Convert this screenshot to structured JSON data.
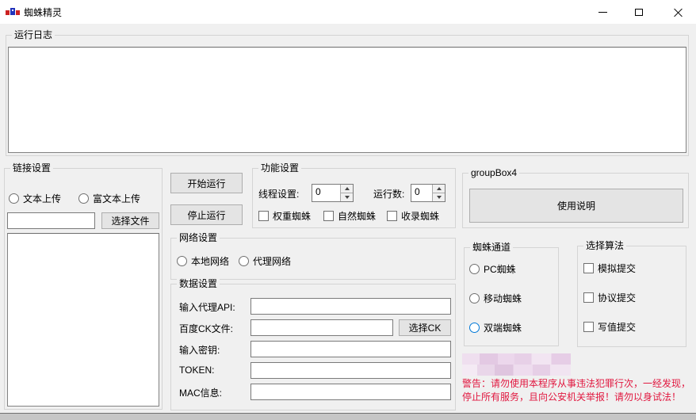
{
  "window": {
    "title": "蜘蛛精灵"
  },
  "icons": {
    "app": "spider-logo-icon",
    "minimize": "minimize-icon",
    "maximize": "maximize-icon",
    "close": "close-icon"
  },
  "log_group": {
    "label": "运行日志",
    "content": ""
  },
  "link_group": {
    "label": "链接设置",
    "radios": [
      {
        "label": "文本上传",
        "checked": false
      },
      {
        "label": "富文本上传",
        "checked": false
      }
    ],
    "file_input_value": "",
    "choose_file_button": "选择文件",
    "list_items": []
  },
  "run_buttons": {
    "start": "开始运行",
    "stop": "停止运行"
  },
  "function_group": {
    "label": "功能设置",
    "thread_label": "线程设置:",
    "thread_value": "0",
    "run_count_label": "运行数:",
    "run_count_value": "0",
    "checkboxes": [
      {
        "label": "权重蜘蛛",
        "checked": false
      },
      {
        "label": "自然蜘蛛",
        "checked": false
      },
      {
        "label": "收录蜘蛛",
        "checked": false
      }
    ]
  },
  "network_group": {
    "label": "网络设置",
    "radios": [
      {
        "label": "本地网络",
        "checked": false
      },
      {
        "label": "代理网络",
        "checked": false
      }
    ]
  },
  "data_group": {
    "label": "数据设置",
    "fields": [
      {
        "label": "输入代理API:",
        "value": ""
      },
      {
        "label": "百度CK文件:",
        "value": "",
        "button": "选择CK"
      },
      {
        "label": "输入密钥:",
        "value": ""
      },
      {
        "label": "TOKEN:",
        "value": ""
      },
      {
        "label": "MAC信息:",
        "value": ""
      }
    ]
  },
  "groupbox4": {
    "label": "groupBox4",
    "help_button": "使用说明"
  },
  "channel_group": {
    "label": "蜘蛛通道",
    "radios": [
      {
        "label": "PC蜘蛛",
        "checked": false,
        "highlighted": false
      },
      {
        "label": "移动蜘蛛",
        "checked": false,
        "highlighted": false
      },
      {
        "label": "双端蜘蛛",
        "checked": false,
        "highlighted": true
      }
    ]
  },
  "algorithm_group": {
    "label": "选择算法",
    "checkboxes": [
      {
        "label": "模拟提交",
        "checked": false
      },
      {
        "label": "协议提交",
        "checked": false
      },
      {
        "label": "写值提交",
        "checked": false
      }
    ]
  },
  "warning": {
    "text": "警告：请勿使用本程序从事违法犯罪行次，一经发现，停止所有服务，且向公安机关举报！请勿以身试法！",
    "color": "#e1173f"
  },
  "colors": {
    "window_background": "#f0f0f0",
    "titlebar_background": "#ffffff",
    "accent_blue": "#0078d7",
    "warning_red": "#e1173f",
    "button_face": "#e4e4e4"
  }
}
